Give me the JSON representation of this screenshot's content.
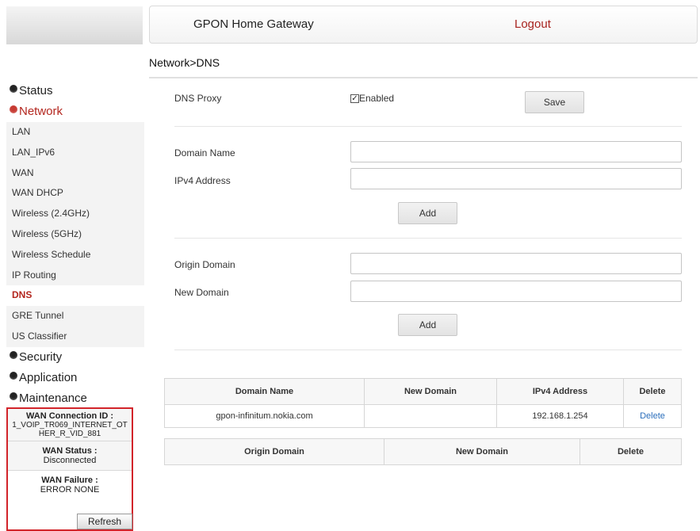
{
  "header": {
    "title": "GPON Home Gateway",
    "logout": "Logout"
  },
  "breadcrumb": "Network>DNS",
  "sidebar": {
    "groups": {
      "status": "Status",
      "network": "Network",
      "security": "Security",
      "application": "Application",
      "maintenance": "Maintenance"
    },
    "network_items": [
      "LAN",
      "LAN_IPv6",
      "WAN",
      "WAN DHCP",
      "Wireless (2.4GHz)",
      "Wireless (5GHz)",
      "Wireless Schedule",
      "IP Routing",
      "DNS",
      "GRE Tunnel",
      "US Classifier"
    ]
  },
  "wan_panel": {
    "connection_id_label": "WAN Connection ID :",
    "connection_id_value": "1_VOIP_TR069_INTERNET_OTHER_R_VID_881",
    "status_label": "WAN Status :",
    "status_value": "Disconnected",
    "failure_label": "WAN Failure :",
    "failure_value": "ERROR NONE",
    "refresh": "Refresh"
  },
  "form": {
    "dns_proxy_label": "DNS Proxy",
    "enabled_label": "Enabled",
    "enabled_checked": true,
    "save": "Save",
    "domain_name_label": "Domain Name",
    "domain_name_value": "",
    "ipv4_label": "IPv4 Address",
    "ipv4_value": "",
    "add": "Add",
    "origin_domain_label": "Origin Domain",
    "origin_domain_value": "",
    "new_domain_label": "New Domain",
    "new_domain_value": ""
  },
  "table1": {
    "headers": [
      "Domain Name",
      "New Domain",
      "IPv4 Address",
      "Delete"
    ],
    "rows": [
      [
        "gpon-infinitum.nokia.com",
        "",
        "192.168.1.254",
        "Delete"
      ]
    ]
  },
  "table2": {
    "headers": [
      "Origin Domain",
      "New Domain",
      "Delete"
    ]
  }
}
